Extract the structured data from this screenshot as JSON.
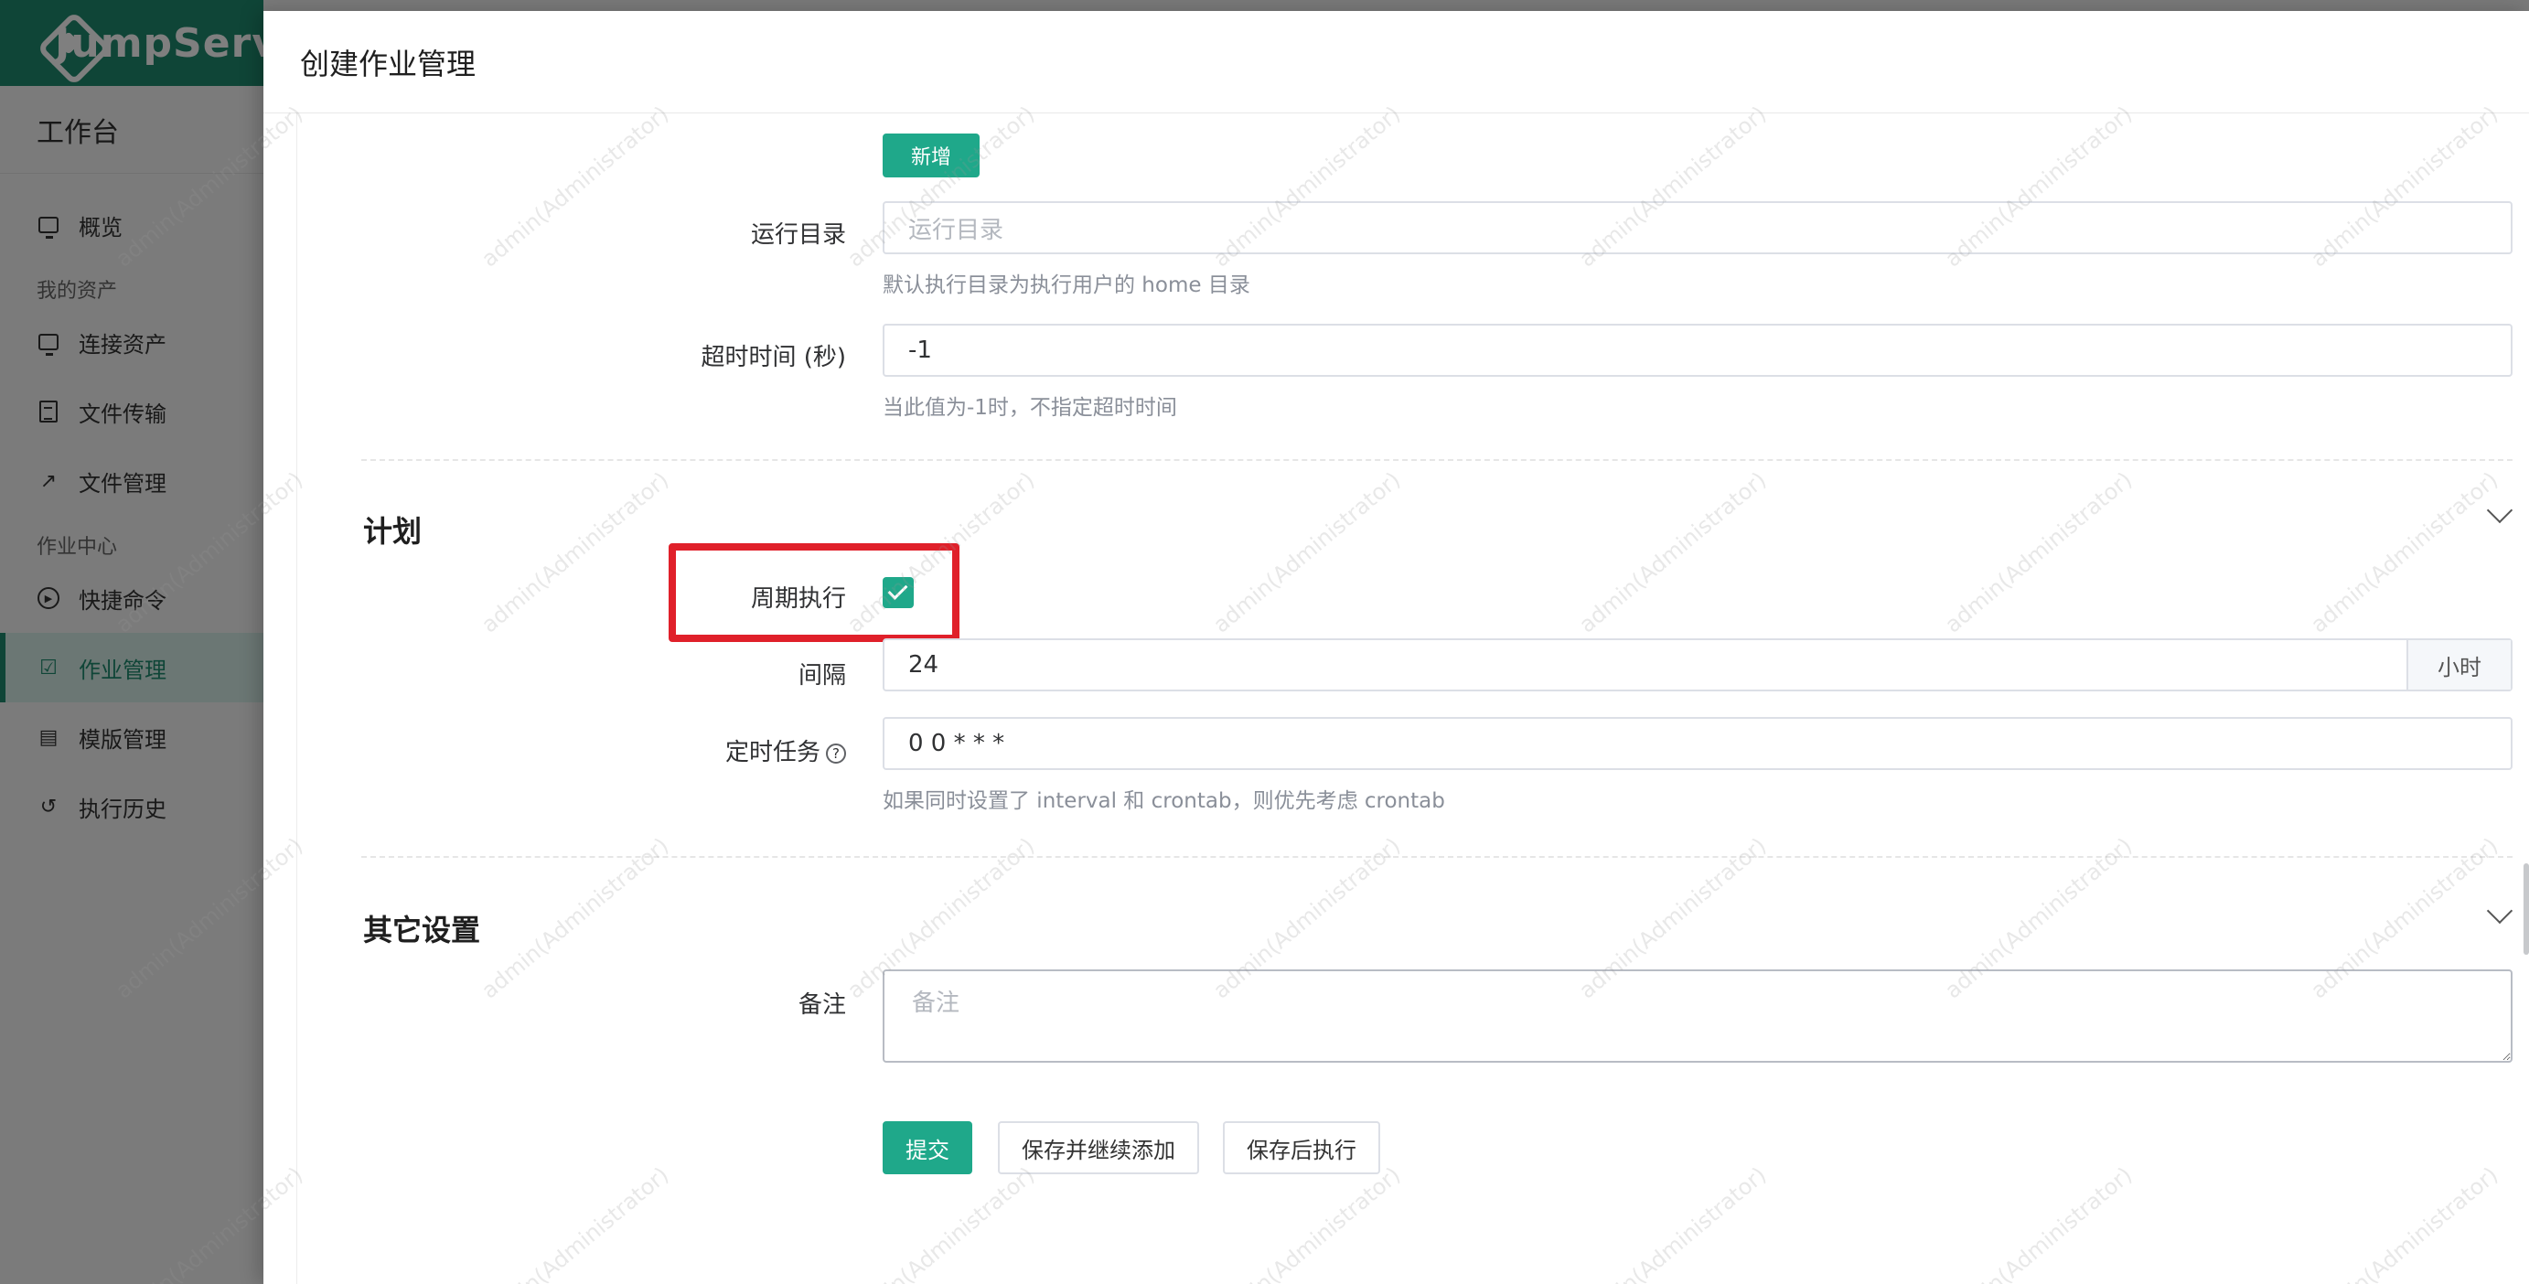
{
  "sidebar": {
    "brand": "JumpServer",
    "workspace": "工作台",
    "items": [
      {
        "label": "概览",
        "icon": "monitor-icon"
      },
      {
        "label": "连接资产",
        "icon": "monitor-icon"
      },
      {
        "label": "文件传输",
        "icon": "file-icon"
      },
      {
        "label": "文件管理",
        "icon": "external-link-icon"
      },
      {
        "label": "快捷命令",
        "icon": "play-circle-icon"
      },
      {
        "label": "作业管理",
        "icon": "checklist-icon"
      },
      {
        "label": "模版管理",
        "icon": "template-icon"
      },
      {
        "label": "执行历史",
        "icon": "history-icon"
      }
    ],
    "groups": {
      "my_assets": "我的资产",
      "job_center": "作业中心"
    },
    "active_item": "作业管理"
  },
  "drawer": {
    "title": "创建作业管理",
    "add_button": "新增",
    "run_dir": {
      "label": "运行目录",
      "placeholder": "运行目录",
      "help": "默认执行目录为执行用户的 home 目录"
    },
    "timeout": {
      "label": "超时时间 (秒)",
      "value": "-1",
      "help": "当此值为-1时，不指定超时时间"
    },
    "plan_section": {
      "title": "计划",
      "periodic": {
        "label": "周期执行",
        "checked": true
      },
      "interval": {
        "label": "间隔",
        "value": "24",
        "unit": "小时"
      },
      "crontab": {
        "label": "定时任务",
        "value": "0 0 * * *",
        "help": "如果同时设置了 interval 和 crontab，则优先考虑 crontab"
      }
    },
    "other_section": {
      "title": "其它设置",
      "comment": {
        "label": "备注",
        "placeholder": "备注"
      }
    },
    "buttons": {
      "submit": "提交",
      "save_continue": "保存并继续添加",
      "save_run": "保存后执行"
    }
  },
  "watermark": "admin(Administrator)",
  "colors": {
    "brand": "#1f8a6e",
    "primary": "#1fa88a",
    "highlight": "#e0202a"
  }
}
